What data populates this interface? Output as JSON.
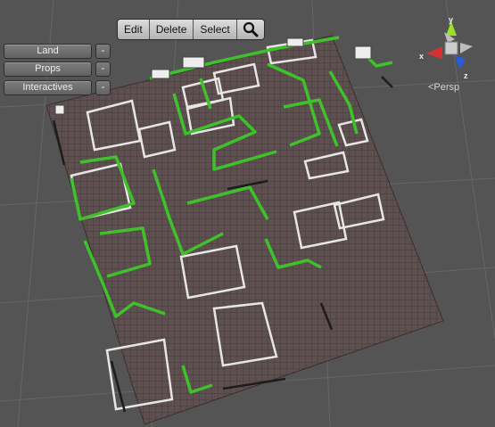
{
  "toolbar": {
    "edit_label": "Edit",
    "delete_label": "Delete",
    "select_label": "Select",
    "search_icon": "magnifier-icon"
  },
  "layers": [
    {
      "label": "Land",
      "remove": "-"
    },
    {
      "label": "Props",
      "remove": "-"
    },
    {
      "label": "Interactives",
      "remove": "-"
    }
  ],
  "gizmo": {
    "x_label": "x",
    "y_label": "y",
    "z_label": "z",
    "projection": "<Persp",
    "colors": {
      "x": "#d83030",
      "y": "#9be02a",
      "z": "#2a5bd8",
      "center": "#cccccc"
    }
  },
  "scene": {
    "ground_color": "#5e5050",
    "highlight_color": "#3fc12b",
    "wall_color": "#e6e6e6",
    "grid_color": "#6b6b6b"
  }
}
